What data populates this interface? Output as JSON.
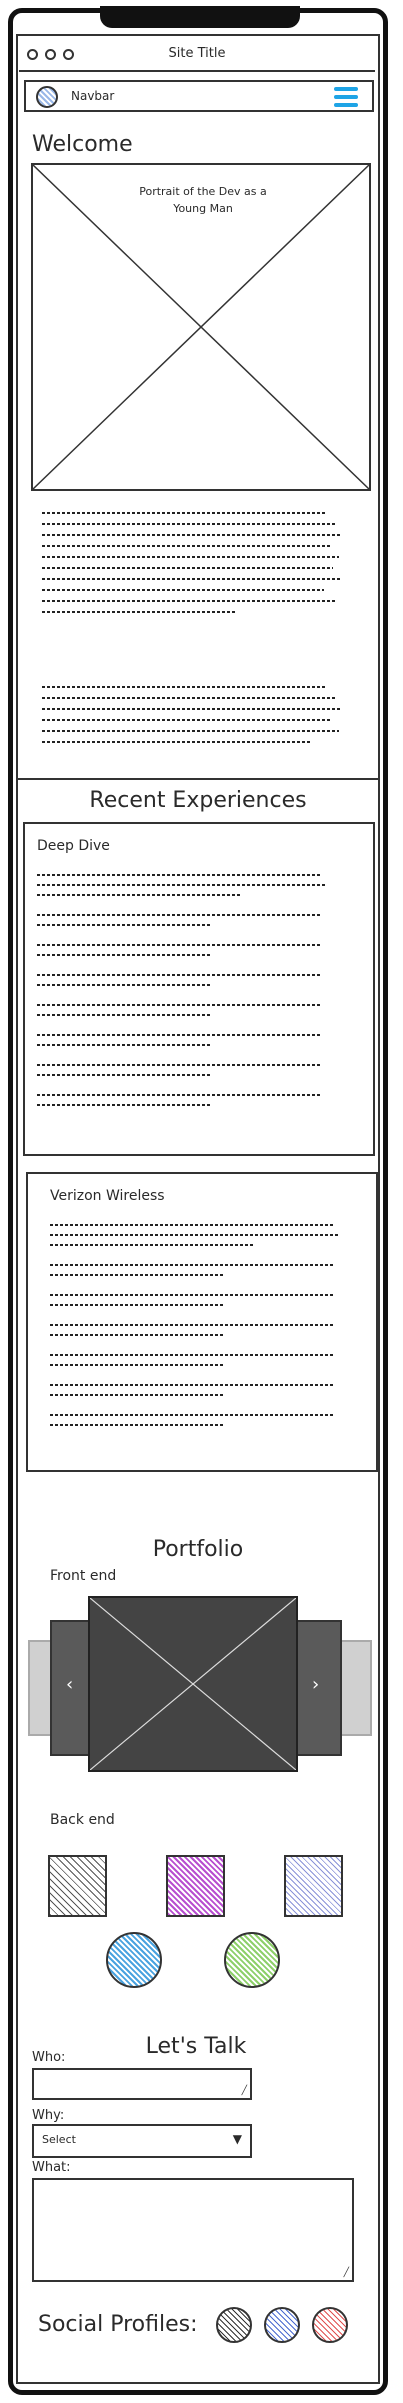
{
  "window": {
    "title": "Site Title"
  },
  "navbar": {
    "label": "Navbar",
    "menu_icon": "hamburger-menu-icon",
    "menu_color": "#1ea4e6"
  },
  "welcome": {
    "title": "Welcome",
    "portrait_caption": "Portrait of the Dev as a Young Man"
  },
  "experiences": {
    "title": "Recent Experiences",
    "cards": [
      {
        "title": "Deep Dive"
      },
      {
        "title": "Verizon Wireless"
      }
    ]
  },
  "portfolio": {
    "title": "Portfolio",
    "front_end_label": "Front end",
    "back_end_label": "Back end",
    "prev_icon": "chevron-left-icon",
    "next_icon": "chevron-right-icon",
    "swatches": [
      "#555555",
      "#b84fd0",
      "#8a93d8",
      "#4aa3e0",
      "#8ed06a"
    ]
  },
  "contact": {
    "title": "Let's Talk",
    "who_label": "Who:",
    "why_label": "Why:",
    "why_selected": "Select",
    "what_label": "What:"
  },
  "social": {
    "title": "Social Profiles:",
    "icons": [
      "#333333",
      "#4a6ad0",
      "#e05050"
    ]
  }
}
